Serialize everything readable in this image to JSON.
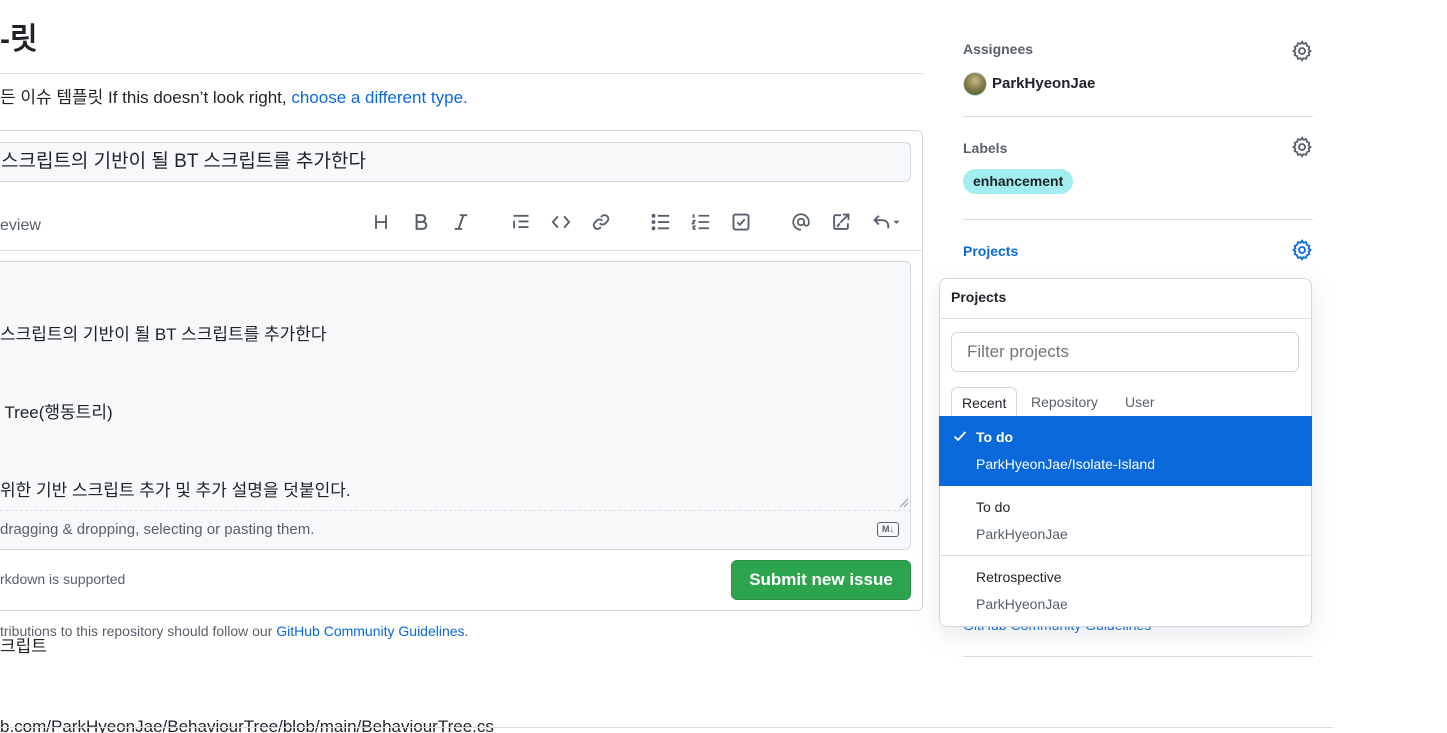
{
  "main": {
    "heading": "-릿",
    "template_text": "든 이슈 템플릿 If this doesn’t look right, ",
    "template_link": "choose a different type.",
    "title_value": "스크립트의 기반이 될 BT 스크립트를 추가한다",
    "preview_tab": "eview",
    "toolbar": {
      "heading": "heading-icon",
      "bold": "bold-icon",
      "italic": "italic-icon",
      "quote": "quote-icon",
      "code": "code-icon",
      "link": "link-icon",
      "unordered_list": "unordered-list-icon",
      "ordered_list": "ordered-list-icon",
      "task_list": "task-list-icon",
      "mention": "mention-icon",
      "reference": "cross-reference-icon",
      "undo": "reply-undo-icon"
    },
    "body_lines": [
      "스크립트의 기반이 될 BT 스크립트를 추가한다",
      " Tree(행동트리)",
      "위한 기반 스크립트 추가 및 추가 설명을 덧붙인다.",
      "",
      "크립트",
      "b.com/ParkHyeonJae/BehaviourTree/blob/main/BehaviourTree.cs"
    ],
    "attach_hint": "dragging & dropping, selecting or pasting them.",
    "markdown_badge": "M↓",
    "markdown_supported": "rkdown is supported",
    "submit_label": "Submit new issue",
    "guidelines_text": "tributions to this repository should follow our ",
    "guidelines_link": "GitHub Community Guidelines",
    "guidelines_end": "."
  },
  "sidebar": {
    "assignees_title": "Assignees",
    "assignee_name": "ParkHyeonJae",
    "labels_title": "Labels",
    "label_name": "enhancement",
    "label_color": "#a2eeef",
    "projects_title": "Projects",
    "guidelines_behind": "GitHub Community Guidelines"
  },
  "projects_dropdown": {
    "header": "Projects",
    "filter_placeholder": "Filter projects",
    "tabs": [
      "Recent",
      "Repository",
      "User"
    ],
    "items": [
      {
        "title": "To do",
        "subtitle": "ParkHyeonJae/Isolate-Island",
        "selected": true
      },
      {
        "title": "To do",
        "subtitle": "ParkHyeonJae",
        "selected": false
      },
      {
        "title": "Retrospective",
        "subtitle": "ParkHyeonJae",
        "selected": false
      }
    ]
  },
  "colors": {
    "accent": "#0969da",
    "submit_green": "#2da44e",
    "border": "#d0d7de"
  }
}
